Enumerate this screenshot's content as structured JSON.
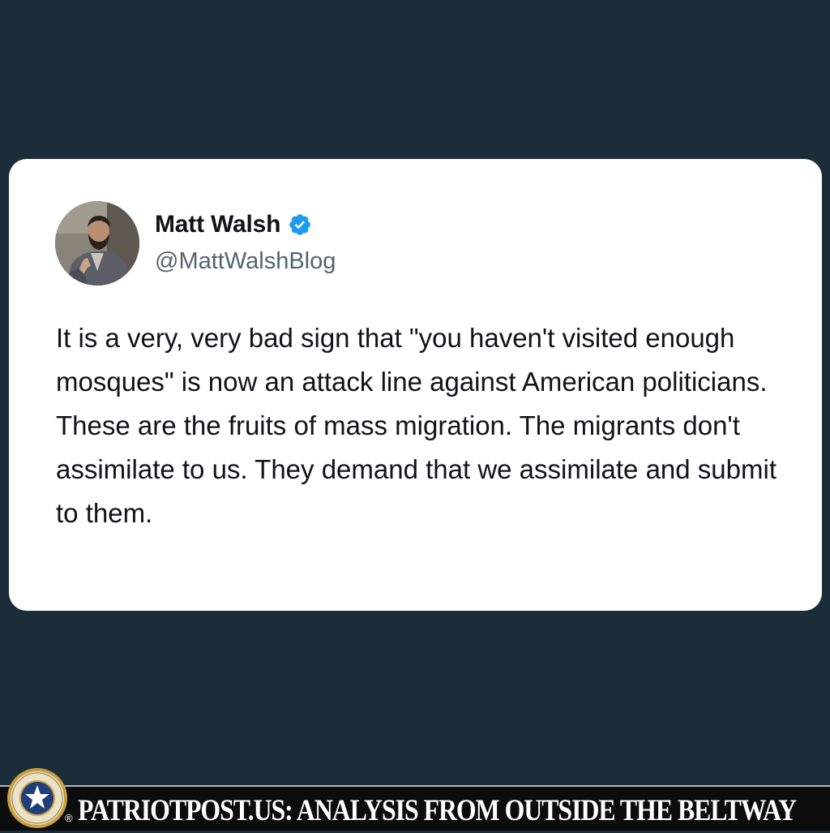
{
  "tweet": {
    "display_name": "Matt Walsh",
    "handle": "@MattWalshBlog",
    "verified": true,
    "avatar_icon": "profile-photo",
    "body": "It is a very, very bad sign that \"you haven't visited enough mosques\" is now an attack line against American politicians. These are the fruits of mass migration. The migrants don't assimilate to us. They demand that we assimilate and submit to them."
  },
  "footer": {
    "registered_mark": "®",
    "text": "PATRIOTPOST.US: ANALYSIS FROM OUTSIDE THE BELTWAY",
    "seal_icon": "star-seal-icon"
  },
  "colors": {
    "background": "#1c2d3a",
    "card": "#ffffff",
    "verified_blue": "#1d9bf0",
    "handle_gray": "#536471",
    "text": "#0f1419",
    "footer_bg": "#0c0c0c",
    "seal_blue": "#1f3f7a",
    "seal_gold": "#c9a040"
  }
}
